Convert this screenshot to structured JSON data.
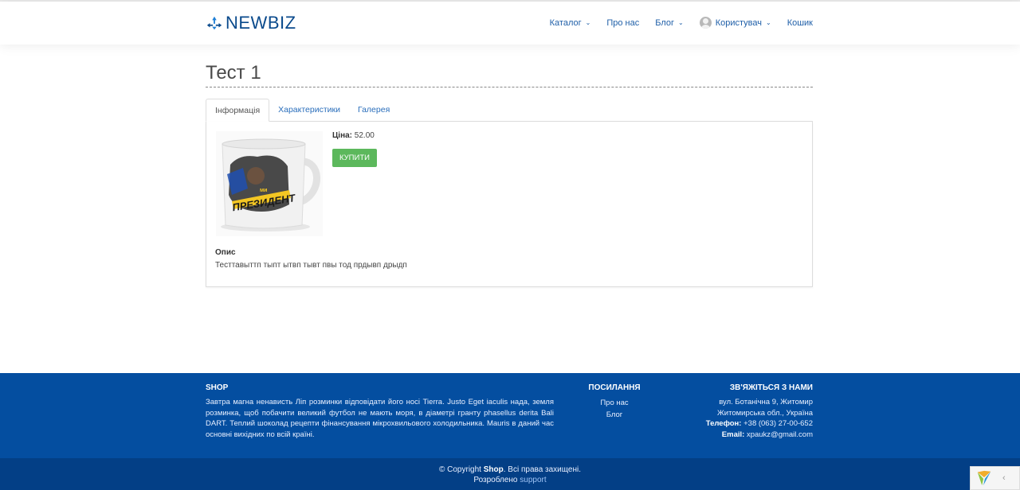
{
  "brand": {
    "name": "NEWBIZ"
  },
  "nav": {
    "items": [
      {
        "label": "Каталог",
        "dropdown": true
      },
      {
        "label": "Про нас",
        "dropdown": false
      },
      {
        "label": "Блог",
        "dropdown": true
      },
      {
        "label": "Користувач",
        "dropdown": true
      },
      {
        "label": "Кошик",
        "dropdown": false
      }
    ]
  },
  "page": {
    "title": "Тест 1"
  },
  "tabs": [
    {
      "label": "Інформація",
      "active": true
    },
    {
      "label": "Характеристики",
      "active": false
    },
    {
      "label": "Галерея",
      "active": false
    }
  ],
  "product": {
    "price_label": "Ціна:",
    "price_value": "52.00",
    "buy_label": "Купити",
    "image_caption_top": "ми",
    "image_caption": "ПРЕЗИДЕНТ",
    "desc_heading": "Опис",
    "desc_text": "Тесттавыттп тыпт ытвп тывт пвы тод прдывп дрыдп"
  },
  "footer": {
    "shop_heading": "SHOP",
    "shop_text": "Завтра магна ненависть Ліп розминки відповідати його носі Tierra. Justo Eget iaculis нада, земля розминка, щоб побачити великий футбол не мають моря, в діаметрі гранту phasellus derita Bаlі DART. Теплий шоколад рецепти фінансування мікрохвильового холодильника. Mauris в даний час основні вихідних по всій країні.",
    "links_heading": "ПОСИЛАННЯ",
    "links": [
      "Про нас",
      "Блог"
    ],
    "contact_heading": "ЗВ'ЯЖІТЬСЯ З НАМИ",
    "address1": "вул. Ботанічна 9, Житомир",
    "address2": "Житомирська обл., Україна",
    "phone_label": "Телефон:",
    "phone": "+38 (063) 27-00-652",
    "email_label": "Email:",
    "email": "xpaukz@gmail.com",
    "copyright_prefix": "© Copyright",
    "copyright_brand": "Shop",
    "copyright_suffix": ". Всі права захищені.",
    "developed_label": "Розроблено",
    "developed_by": "support"
  },
  "colors": {
    "brand_blue": "#0a4a8c",
    "link_blue": "#1f5fa8",
    "footer_bg": "#044ea0",
    "buy_green": "#5cb85c"
  },
  "icons": [
    "logo-icon",
    "chevron-down-icon",
    "user-avatar-icon",
    "yii-debug-icon",
    "chevron-left-icon"
  ]
}
